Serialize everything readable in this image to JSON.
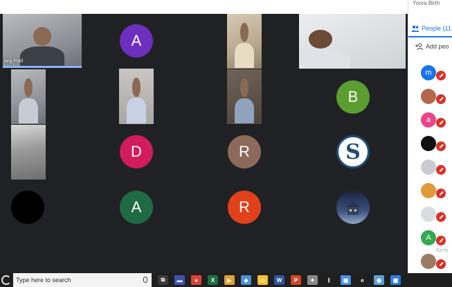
{
  "colors": {
    "meet_background": "#202124",
    "accent_blue": "#1a73e8",
    "mic_off_red": "#d93025",
    "active_speaker": "#8ab4f8",
    "taskbar": "#1f1f1f"
  },
  "panel": {
    "top_text": "Yoora Birth",
    "people_tab_label": "People (11",
    "add_people_label": "Add peo",
    "bottom_text": "Go to"
  },
  "grid": {
    "tiles": [
      {
        "kind": "video",
        "name": "ang Patil",
        "active": true
      },
      {
        "kind": "avatar",
        "initial": "A",
        "color": "#6d2fbf"
      },
      {
        "kind": "video"
      },
      {
        "kind": "video"
      },
      {
        "kind": "video"
      },
      {
        "kind": "video"
      },
      {
        "kind": "video"
      },
      {
        "kind": "avatar",
        "initial": "B",
        "color": "#5a9e2f"
      },
      {
        "kind": "video"
      },
      {
        "kind": "avatar",
        "initial": "D",
        "color": "#d01c5b"
      },
      {
        "kind": "avatar",
        "initial": "R",
        "color": "#8b6a5c"
      },
      {
        "kind": "avatar-image",
        "icon": "logo-s-icon"
      },
      {
        "kind": "avatar",
        "initial": "",
        "color": "#000000"
      },
      {
        "kind": "avatar",
        "initial": "A",
        "color": "#1e6b43"
      },
      {
        "kind": "avatar",
        "initial": "R",
        "color": "#e2401b"
      },
      {
        "kind": "avatar-image",
        "icon": "house-night-icon"
      }
    ]
  },
  "participants": [
    {
      "initial": "m",
      "color": "#1a73e8",
      "mic": "off"
    },
    {
      "initial": "",
      "color": "#b5674a",
      "mic": "off"
    },
    {
      "initial": "a",
      "color": "#e8458b",
      "mic": "off"
    },
    {
      "initial": "",
      "color": "#111111",
      "mic": "off"
    },
    {
      "initial": "",
      "color": "#c9cdd2",
      "mic": "off"
    },
    {
      "initial": "",
      "color": "#e09a3a",
      "mic": "off"
    },
    {
      "initial": "",
      "color": "#dadce0",
      "mic": "off"
    },
    {
      "initial": "A",
      "color": "#34a853",
      "mic": "off"
    },
    {
      "initial": "",
      "color": "#9c7a63",
      "mic": "off"
    }
  ],
  "taskbar": {
    "search_placeholder": "Type here to search",
    "pinned_icons": [
      {
        "name": "task-view-icon",
        "color": "#3a3a3a",
        "glyph": "⧉"
      },
      {
        "name": "app-icon",
        "color": "#3f51b5",
        "glyph": "▬"
      },
      {
        "name": "chrome-icon",
        "color": "#db4437",
        "glyph": "●"
      },
      {
        "name": "excel-icon",
        "color": "#1d6f42",
        "glyph": "X"
      },
      {
        "name": "media-icon",
        "color": "#e0a030",
        "glyph": "▶"
      },
      {
        "name": "app-icon",
        "color": "#4a8fd8",
        "glyph": "◆"
      },
      {
        "name": "file-explorer-icon",
        "color": "#f2c12e",
        "glyph": "▭"
      },
      {
        "name": "word-icon",
        "color": "#2b579a",
        "glyph": "W"
      },
      {
        "name": "powerpoint-icon",
        "color": "#d24726",
        "glyph": "P"
      },
      {
        "name": "app-icon",
        "color": "#8a8a8a",
        "glyph": "✦"
      },
      {
        "name": "bluetooth-icon",
        "color": "#1f1f1f",
        "glyph": "ᛒ"
      },
      {
        "name": "app-icon",
        "color": "#4a90e2",
        "glyph": "▣"
      },
      {
        "name": "edge-icon",
        "color": "#1f1f1f",
        "glyph": "e"
      },
      {
        "name": "app-icon",
        "color": "#5aa0d8",
        "glyph": "◉"
      },
      {
        "name": "app-icon",
        "color": "#2a7de1",
        "glyph": "▦"
      }
    ]
  }
}
